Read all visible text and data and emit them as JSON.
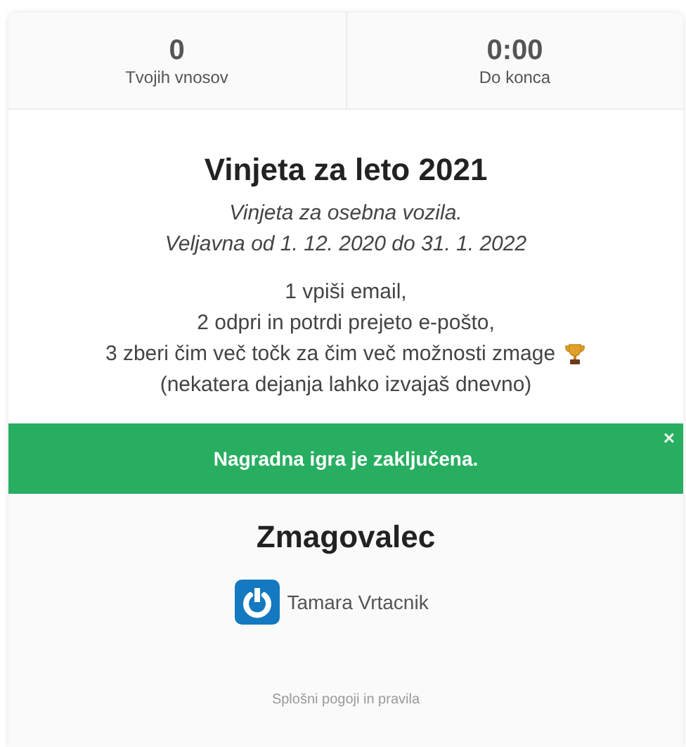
{
  "stats": [
    {
      "value": "0",
      "label": "Tvojih vnosov"
    },
    {
      "value": "0:00",
      "label": "Do konca"
    }
  ],
  "title": "Vinjeta za leto 2021",
  "subtitle_lines": [
    "Vinjeta za osebna vozila.",
    "Veljavna od 1. 12. 2020 do 31. 1. 2022"
  ],
  "steps": [
    {
      "kind": "plain",
      "text": "1 vpiši email,"
    },
    {
      "kind": "plain",
      "text": "2 odpri in potrdi prejeto e-pošto,"
    },
    {
      "kind": "trophy",
      "text": "3 zberi čim več točk za čim več možnosti zmage"
    },
    {
      "kind": "plain",
      "text": "(nekatera dejanja lahko izvajaš dnevno)"
    }
  ],
  "banner": {
    "text": "Nagradna igra je zaključena.",
    "close": "×"
  },
  "winner": {
    "heading": "Zmagovalec",
    "name": "Tamara Vrtacnik"
  },
  "footer_link": "Splošni pogoji in pravila"
}
